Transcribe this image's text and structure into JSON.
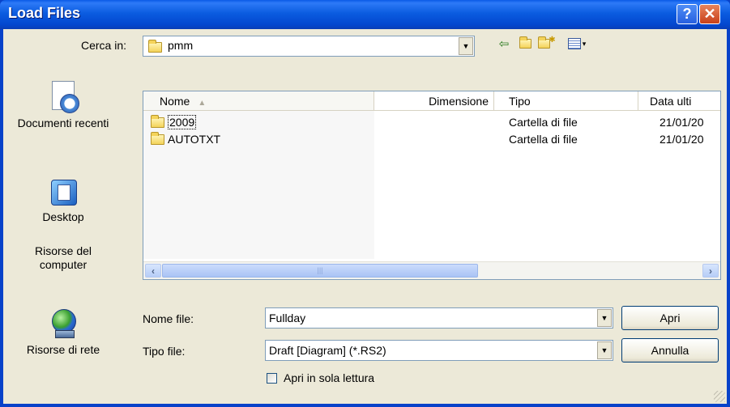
{
  "window": {
    "title": "Load Files",
    "help_label": "?",
    "close_label": "✕"
  },
  "look_in": {
    "label": "Cerca in:",
    "value": "pmm"
  },
  "toolbar": {
    "back_icon": "back-arrow-icon",
    "up_icon": "up-folder-icon",
    "new_folder_icon": "new-folder-icon",
    "view_menu_icon": "view-menu-icon"
  },
  "places": [
    {
      "label": "Documenti recenti",
      "icon": "recent-documents-icon"
    },
    {
      "label": "Desktop",
      "icon": "desktop-icon"
    },
    {
      "label": "Risorse del computer",
      "icon": "my-computer-icon"
    },
    {
      "label": "Risorse di rete",
      "icon": "network-icon"
    }
  ],
  "columns": [
    "Nome",
    "Dimensione",
    "Tipo",
    "Data ulti"
  ],
  "files": [
    {
      "name": "2009",
      "size": "",
      "type": "Cartella di file",
      "date": "21/01/20"
    },
    {
      "name": "AUTOTXT",
      "size": "",
      "type": "Cartella di file",
      "date": "21/01/20"
    }
  ],
  "file_name": {
    "label": "Nome file:",
    "value": "Fullday"
  },
  "file_type": {
    "label": "Tipo file:",
    "value": "Draft [Diagram]  (*.RS2)"
  },
  "readonly": {
    "label": "Apri in sola lettura",
    "checked": false
  },
  "buttons": {
    "open": "Apri",
    "cancel": "Annulla"
  }
}
